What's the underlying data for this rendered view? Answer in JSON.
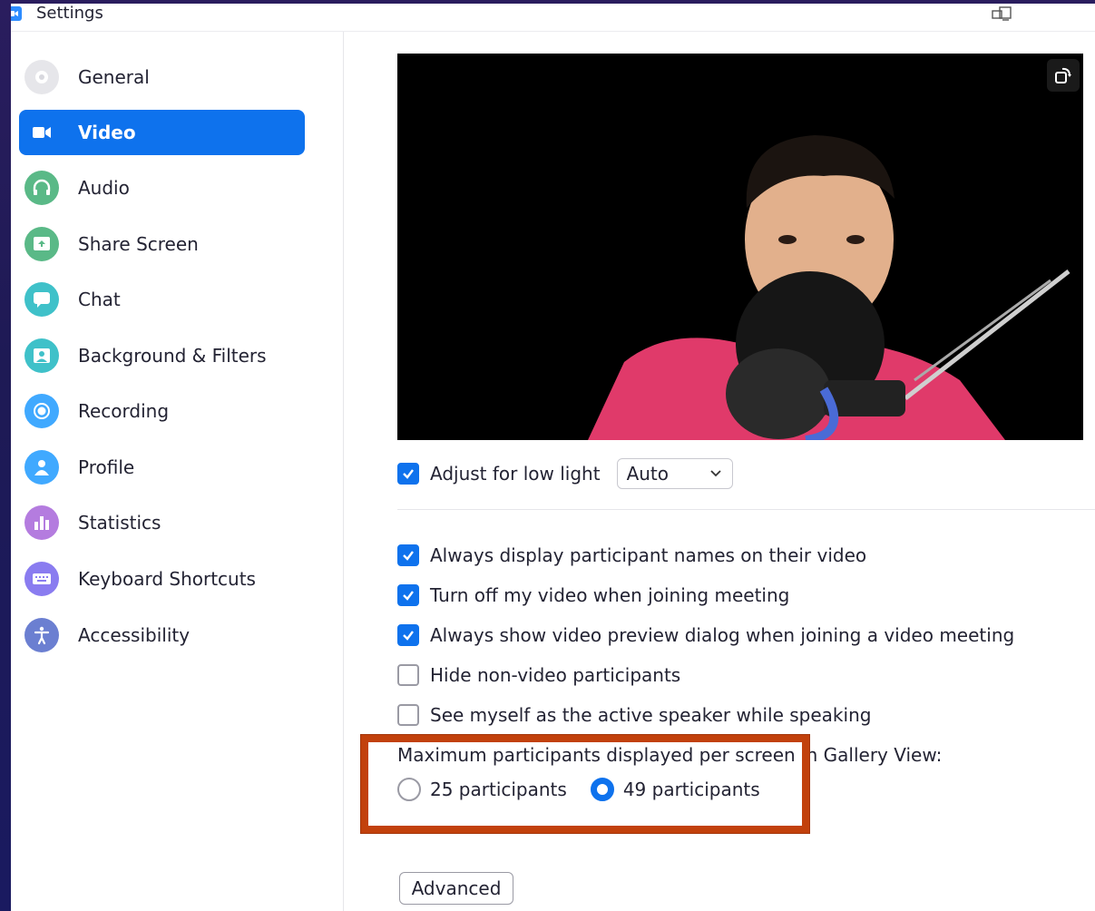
{
  "window": {
    "title": "Settings"
  },
  "sidebar": {
    "items": [
      {
        "label": "General",
        "icon": "gear-icon",
        "color": "#e6e6ea",
        "active": false
      },
      {
        "label": "Video",
        "icon": "video-camera-icon",
        "color": "#0e72ed",
        "active": true
      },
      {
        "label": "Audio",
        "icon": "headphones-icon",
        "color": "#5ab987",
        "active": false
      },
      {
        "label": "Share Screen",
        "icon": "share-screen-icon",
        "color": "#5ab987",
        "active": false
      },
      {
        "label": "Chat",
        "icon": "chat-bubble-icon",
        "color": "#3fc1c9",
        "active": false
      },
      {
        "label": "Background & Filters",
        "icon": "background-icon",
        "color": "#3fc1c9",
        "active": false
      },
      {
        "label": "Recording",
        "icon": "record-icon",
        "color": "#40a9ff",
        "active": false
      },
      {
        "label": "Profile",
        "icon": "user-icon",
        "color": "#40a9ff",
        "active": false
      },
      {
        "label": "Statistics",
        "icon": "bar-chart-icon",
        "color": "#b47cdf",
        "active": false
      },
      {
        "label": "Keyboard Shortcuts",
        "icon": "keyboard-icon",
        "color": "#8a7cf0",
        "active": false
      },
      {
        "label": "Accessibility",
        "icon": "accessibility-icon",
        "color": "#6b7fd1",
        "active": false
      }
    ]
  },
  "main": {
    "low_light": {
      "label": "Adjust for low light",
      "checked": true,
      "select_value": "Auto"
    },
    "options": [
      {
        "label": "Always display participant names on their video",
        "checked": true
      },
      {
        "label": "Turn off my video when joining meeting",
        "checked": true
      },
      {
        "label": "Always show video preview dialog when joining a video meeting",
        "checked": true
      },
      {
        "label": "Hide non-video participants",
        "checked": false
      },
      {
        "label": "See myself as the active speaker while speaking",
        "checked": false
      }
    ],
    "gallery": {
      "label": "Maximum participants displayed per screen in Gallery View:",
      "options": [
        {
          "label": "25 participants",
          "selected": false
        },
        {
          "label": "49 participants",
          "selected": true
        }
      ]
    },
    "advanced_label": "Advanced"
  },
  "colors": {
    "accent": "#0e72ed",
    "highlight": "#c2410c"
  }
}
